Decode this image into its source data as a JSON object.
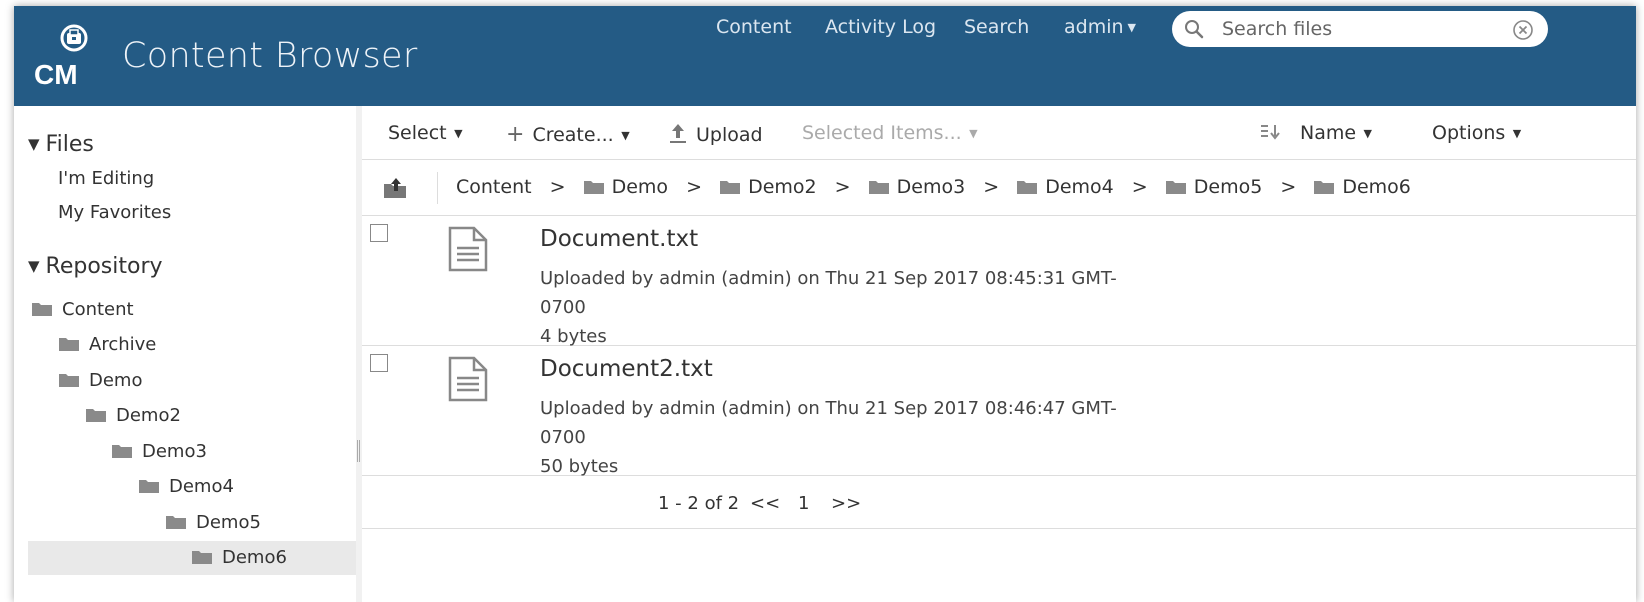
{
  "header": {
    "logo_text": "CM",
    "title": "Content Browser",
    "nav": {
      "content": "Content",
      "activity_log": "Activity Log",
      "search": "Search",
      "user": "admin"
    },
    "search": {
      "placeholder": "Search files",
      "value": ""
    }
  },
  "sidebar": {
    "files_heading": "Files",
    "files_links": [
      "I'm Editing",
      "My Favorites"
    ],
    "repository_heading": "Repository",
    "tree": [
      "Content",
      "Archive",
      "Demo",
      "Demo2",
      "Demo3",
      "Demo4",
      "Demo5",
      "Demo6"
    ],
    "selected": "Demo6"
  },
  "toolbar": {
    "select": "Select",
    "create": "Create...",
    "upload": "Upload",
    "selected_items": "Selected Items...",
    "sort": "Name",
    "options": "Options"
  },
  "breadcrumb": {
    "root": "Content",
    "folders": [
      "Demo",
      "Demo2",
      "Demo3",
      "Demo4",
      "Demo5",
      "Demo6"
    ],
    "separator": ">"
  },
  "files": [
    {
      "name": "Document.txt",
      "uploaded_line1": "Uploaded by admin (admin) on Thu 21 Sep 2017 08:45:31 GMT-",
      "uploaded_line2": "0700",
      "size": "4 bytes"
    },
    {
      "name": "Document2.txt",
      "uploaded_line1": "Uploaded by admin (admin) on Thu 21 Sep 2017 08:46:47 GMT-",
      "uploaded_line2": "0700",
      "size": "50 bytes"
    }
  ],
  "pagination": {
    "range": "1 - 2 of 2",
    "prev": "<<",
    "page": "1",
    "next": ">>"
  },
  "colors": {
    "header_bg": "#245b85",
    "selected_bg": "#e9e9e9",
    "icon_gray": "#8a8a8a"
  },
  "icons": [
    "logo-icon",
    "search-icon",
    "clear-icon",
    "caret-down-icon",
    "folder-icon",
    "plus-icon",
    "upload-icon",
    "sort-icon",
    "up-folder-icon",
    "document-icon"
  ]
}
